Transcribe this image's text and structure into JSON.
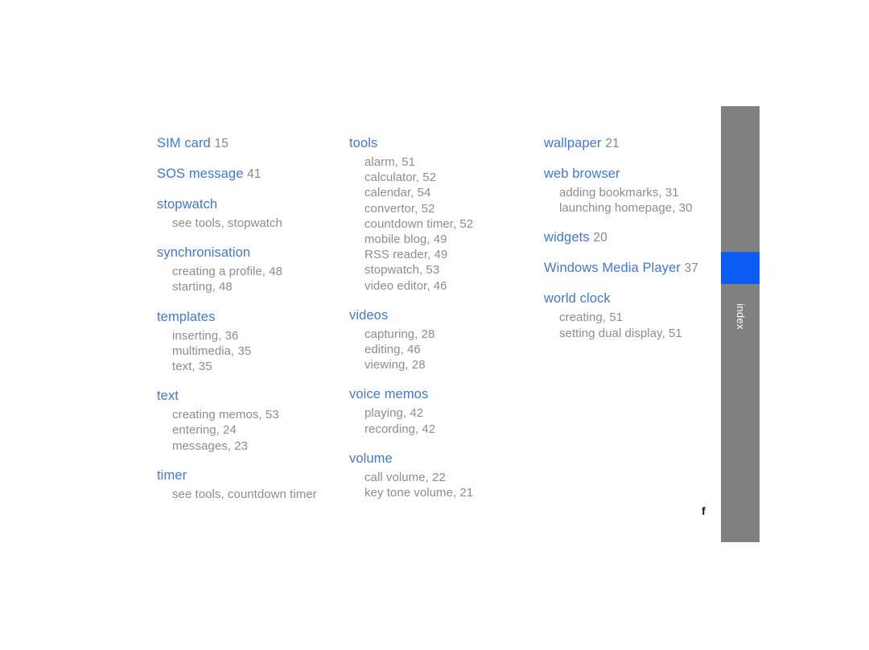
{
  "document": {
    "section_label": "index",
    "page_marker": "f"
  },
  "colors": {
    "heading_blue": "#4277d6",
    "subentry_grey": "#8a8d91",
    "tab_grey": "#808080",
    "tab_highlight_blue": "#0a5cf5",
    "page_background": "#ffffff"
  },
  "columns": [
    {
      "entries": [
        {
          "term": "SIM card",
          "page": "15",
          "subentries": []
        },
        {
          "term": "SOS message",
          "page": "41",
          "subentries": []
        },
        {
          "term": "stopwatch",
          "page": "",
          "subentries": [
            "see tools, stopwatch"
          ]
        },
        {
          "term": "synchronisation",
          "page": "",
          "subentries": [
            "creating a profile, 48",
            "starting, 48"
          ]
        },
        {
          "term": "templates",
          "page": "",
          "subentries": [
            "inserting, 36",
            "multimedia, 35",
            "text, 35"
          ]
        },
        {
          "term": "text",
          "page": "",
          "subentries": [
            "creating memos, 53",
            "entering, 24",
            "messages, 23"
          ]
        },
        {
          "term": "timer",
          "page": "",
          "subentries": [
            "see tools, countdown timer"
          ]
        }
      ]
    },
    {
      "entries": [
        {
          "term": "tools",
          "page": "",
          "subentries": [
            "alarm, 51",
            "calculator, 52",
            "calendar, 54",
            "convertor, 52",
            "countdown timer, 52",
            "mobile blog, 49",
            "RSS reader, 49",
            "stopwatch, 53",
            "video editor, 46"
          ]
        },
        {
          "term": "videos",
          "page": "",
          "subentries": [
            "capturing, 28",
            "editing, 46",
            "viewing, 28"
          ]
        },
        {
          "term": "voice memos",
          "page": "",
          "subentries": [
            "playing, 42",
            "recording, 42"
          ]
        },
        {
          "term": "volume",
          "page": "",
          "subentries": [
            "call volume, 22",
            "key tone volume, 21"
          ]
        }
      ]
    },
    {
      "entries": [
        {
          "term": "wallpaper",
          "page": "21",
          "subentries": []
        },
        {
          "term": "web browser",
          "page": "",
          "subentries": [
            "adding bookmarks, 31",
            "launching homepage, 30"
          ]
        },
        {
          "term": "widgets",
          "page": "20",
          "subentries": []
        },
        {
          "term": "Windows Media Player",
          "page": "37",
          "subentries": []
        },
        {
          "term": "world clock",
          "page": "",
          "subentries": [
            "creating, 51",
            "setting dual display, 51"
          ]
        }
      ]
    }
  ]
}
